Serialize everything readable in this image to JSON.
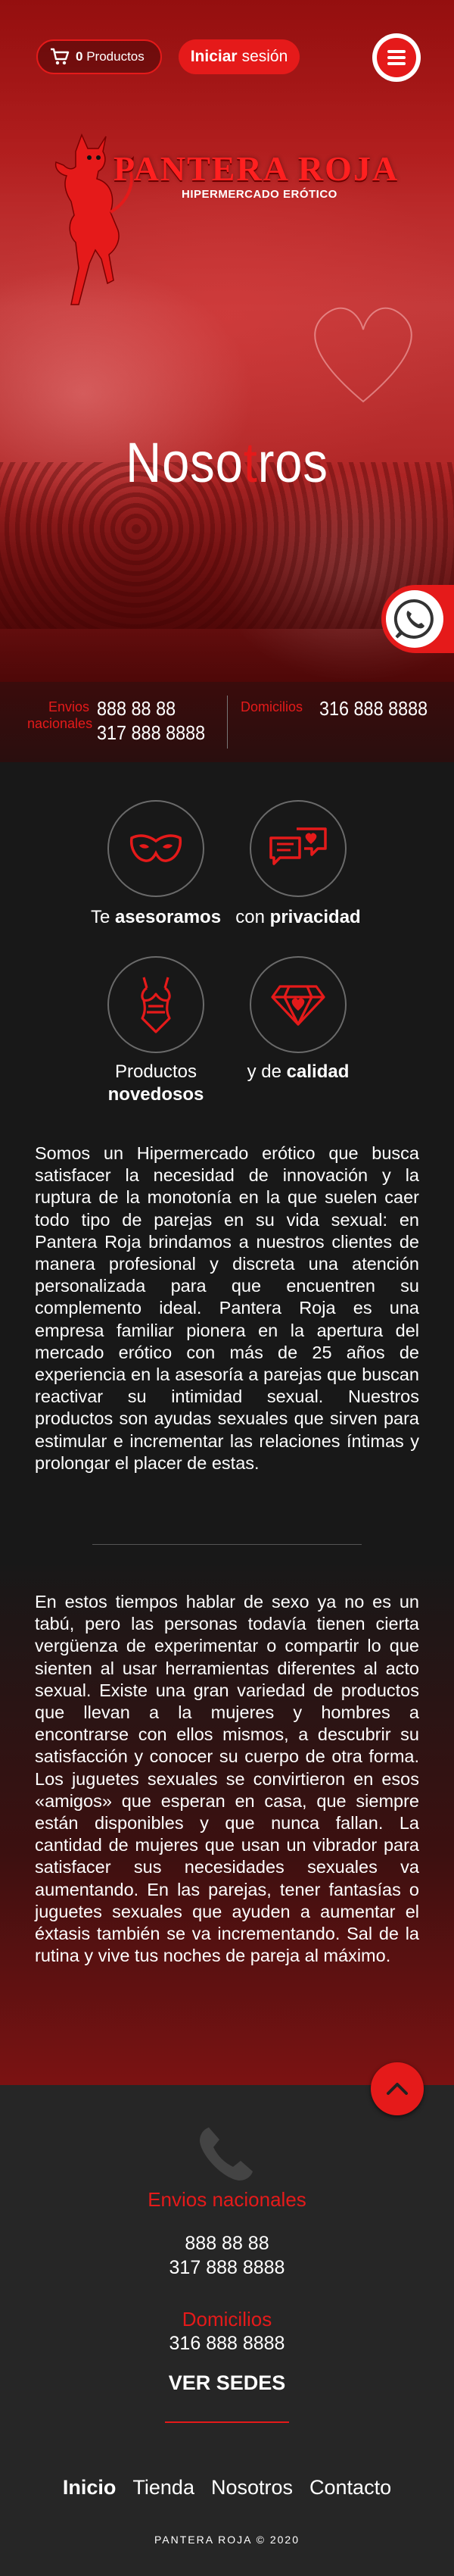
{
  "header": {
    "cart_count": "0",
    "cart_label": "Productos",
    "login_bold": "Iniciar",
    "login_rest": "sesión"
  },
  "brand": {
    "name": "PANTERA ROJA",
    "tagline": "HIPERMERCADO ERÓTICO"
  },
  "hero": {
    "title_before": "Noso",
    "title_accent": "t",
    "title_after": "ros"
  },
  "contact_strip": {
    "envios_label_1": "Envios",
    "envios_label_2": "nacionales",
    "envios_phone_1": "888 88 88",
    "envios_phone_2": "317 888 8888",
    "domicilios_label": "Domicilios",
    "domicilios_phone": "316 888 8888"
  },
  "features": [
    {
      "pre": "Te ",
      "bold": "asesoramos",
      "icon": "mask-icon"
    },
    {
      "pre": "con ",
      "bold": "privacidad",
      "icon": "chat-heart-icon"
    },
    {
      "pre": "Productos",
      "bold": "novedosos",
      "icon": "lingerie-icon"
    },
    {
      "pre": "y de ",
      "bold": "calidad",
      "icon": "diamond-heart-icon"
    }
  ],
  "about": {
    "paragraph_1": "Somos un Hipermercado erótico que busca satisfacer la necesidad de innovación y la ruptura de la monotonía en la que suelen caer todo tipo de parejas en su vida sexual: en Pantera Roja brindamos a nuestros clientes de manera profesional y discreta una atención personalizada para que encuentren su complemento ideal. Pantera Roja es una empresa familiar pionera en la apertura del mercado erótico con más de 25 años de experiencia en la asesoría a parejas que buscan reactivar su intimidad sexual. Nuestros productos son ayudas sexuales que sirven para estimular e incrementar las relaciones íntimas y prolongar el placer de estas.",
    "paragraph_2": "En estos tiempos hablar de sexo ya no es un tabú, pero las personas todavía tienen cierta vergüenza de experimentar o compartir lo que sienten al usar herramientas diferentes al acto sexual. Existe una gran variedad de productos que llevan a la mujeres y hombres a encontrarse con ellos mismos, a descubrir su satisfacción y conocer su cuerpo de otra forma. Los juguetes sexuales se convirtieron en esos «amigos» que esperan en casa, que siempre están disponibles y que nunca fallan. La cantidad de mujeres que usan un vibrador para satisfacer sus necesidades sexuales va aumentando. En las parejas, tener fantasías o juguetes sexuales que ayuden a aumentar el éxtasis también se va incrementando. Sal de la rutina y vive tus noches de pareja al máximo."
  },
  "footer": {
    "envios_label": "Envios nacionales",
    "envios_phone_1": "888 88 88",
    "envios_phone_2": "317 888 8888",
    "domicilios_label": "Domicilios",
    "domicilios_phone": "316 888 8888",
    "sedes": "VER SEDES",
    "nav": [
      "Inicio",
      "Tienda",
      "Nosotros",
      "Contacto"
    ],
    "copyright": "PANTERA ROJA © 2020"
  },
  "colors": {
    "accent": "#e51a1a",
    "background": "#181818",
    "footer_bg": "#262626"
  }
}
